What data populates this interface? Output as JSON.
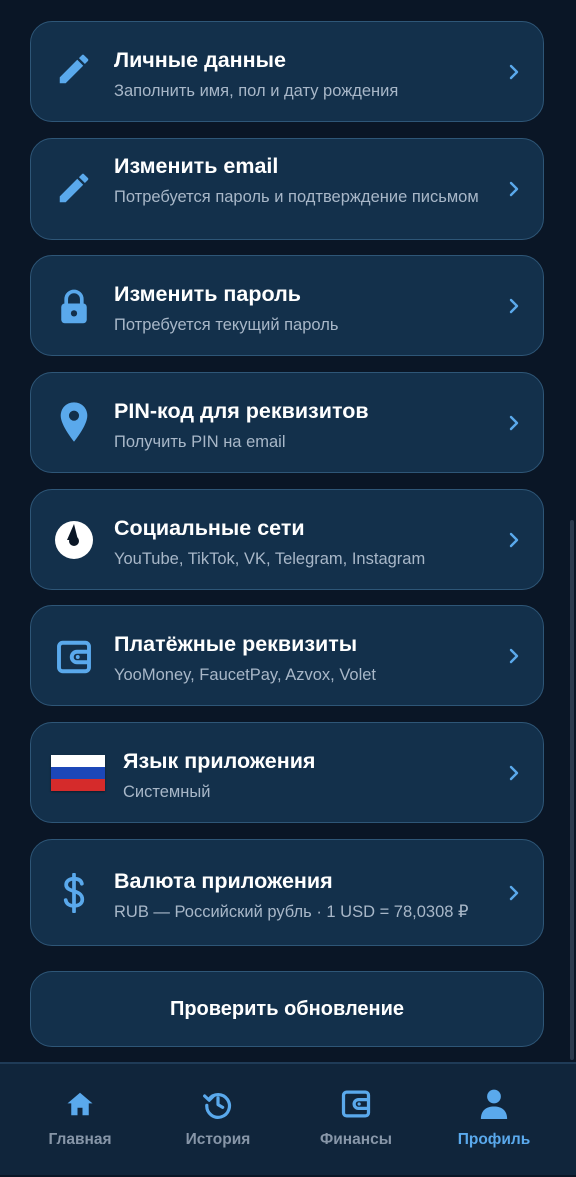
{
  "colors": {
    "background": "#0a1626",
    "card": "#13304b",
    "card_border": "#2e5677",
    "accent": "#5aa9ec",
    "nav_inactive": "#8796a8"
  },
  "settings": [
    {
      "icon": "pencil-icon",
      "title": "Личные данные",
      "subtitle": "Заполнить имя, пол и дату рождения"
    },
    {
      "icon": "pencil-icon",
      "title": "Изменить email",
      "subtitle": "Потребуется пароль и подтверждение письмом"
    },
    {
      "icon": "lock-icon",
      "title": "Изменить пароль",
      "subtitle": "Потребуется текущий пароль"
    },
    {
      "icon": "location-pin-icon",
      "title": "PIN-код для реквизитов",
      "subtitle": "Получить PIN на email"
    },
    {
      "icon": "social-clock-icon",
      "title": "Социальные сети",
      "subtitle": "YouTube, TikTok, VK, Telegram, Instagram"
    },
    {
      "icon": "wallet-icon",
      "title": "Платёжные реквизиты",
      "subtitle": "YooMoney, FaucetPay, Azvox, Volet"
    },
    {
      "icon": "russian-flag-icon",
      "title": "Язык приложения",
      "subtitle": "Системный"
    },
    {
      "icon": "dollar-icon",
      "title": "Валюта приложения",
      "subtitle": "RUB — Российский рубль · 1 USD = 78,0308 ₽"
    }
  ],
  "update_button": {
    "label": "Проверить обновление"
  },
  "nav": {
    "items": [
      {
        "icon": "home-icon",
        "label": "Главная",
        "active": false
      },
      {
        "icon": "history-icon",
        "label": "История",
        "active": false
      },
      {
        "icon": "wallet-icon",
        "label": "Финансы",
        "active": false
      },
      {
        "icon": "profile-icon",
        "label": "Профиль",
        "active": true
      }
    ]
  }
}
